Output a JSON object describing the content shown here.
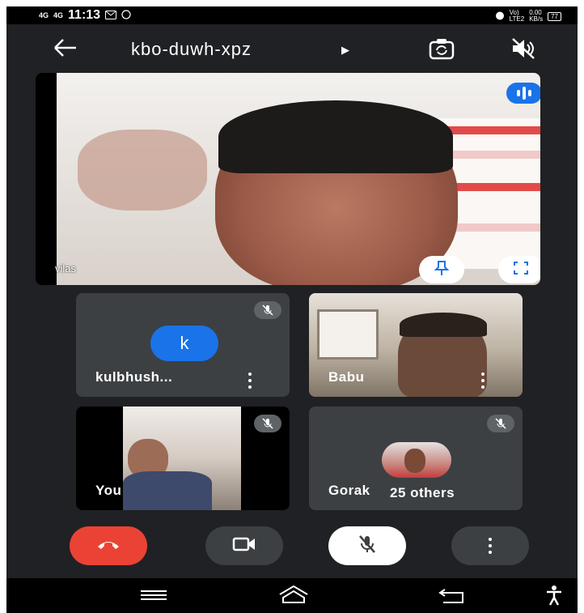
{
  "status_bar": {
    "network_1": "4G",
    "network_2": "4G",
    "time": "11:13",
    "data_rate_top": "0.00",
    "data_rate_unit": "KB/s",
    "lte_top": "Vo)",
    "lte_bottom": "LTE2",
    "battery": "77"
  },
  "header": {
    "meeting_code": "kbo-duwh-xpz",
    "back_icon": "arrow-left-icon",
    "camera_switch_icon": "camera-switch-icon",
    "speaker_icon": "speaker-muted-icon"
  },
  "main_speaker": {
    "name": "vilas",
    "speaking_indicator": "audio-wave-icon",
    "pin_icon": "pin-icon",
    "fullscreen_icon": "fullscreen-icon"
  },
  "tiles": [
    {
      "name": "kulbhush...",
      "avatar_letter": "k",
      "muted": true
    },
    {
      "name": "Babu",
      "muted": false
    },
    {
      "name": "You",
      "muted": true
    },
    {
      "name": "Gorak",
      "others_label": "25 others",
      "muted": true
    }
  ],
  "controls": {
    "end_call_icon": "end-call-icon",
    "video_icon": "video-camera-icon",
    "mic_icon": "mic-off-icon",
    "more_icon": "more-vertical-icon"
  },
  "nav": {
    "menu_icon": "menu-icon",
    "home_icon": "home-icon",
    "back_icon": "nav-back-icon",
    "accessibility_icon": "accessibility-icon"
  },
  "colors": {
    "end_call": "#ea4335",
    "accent_blue": "#1a73e8",
    "tile_bg": "#3c4043",
    "app_bg": "#202124"
  }
}
